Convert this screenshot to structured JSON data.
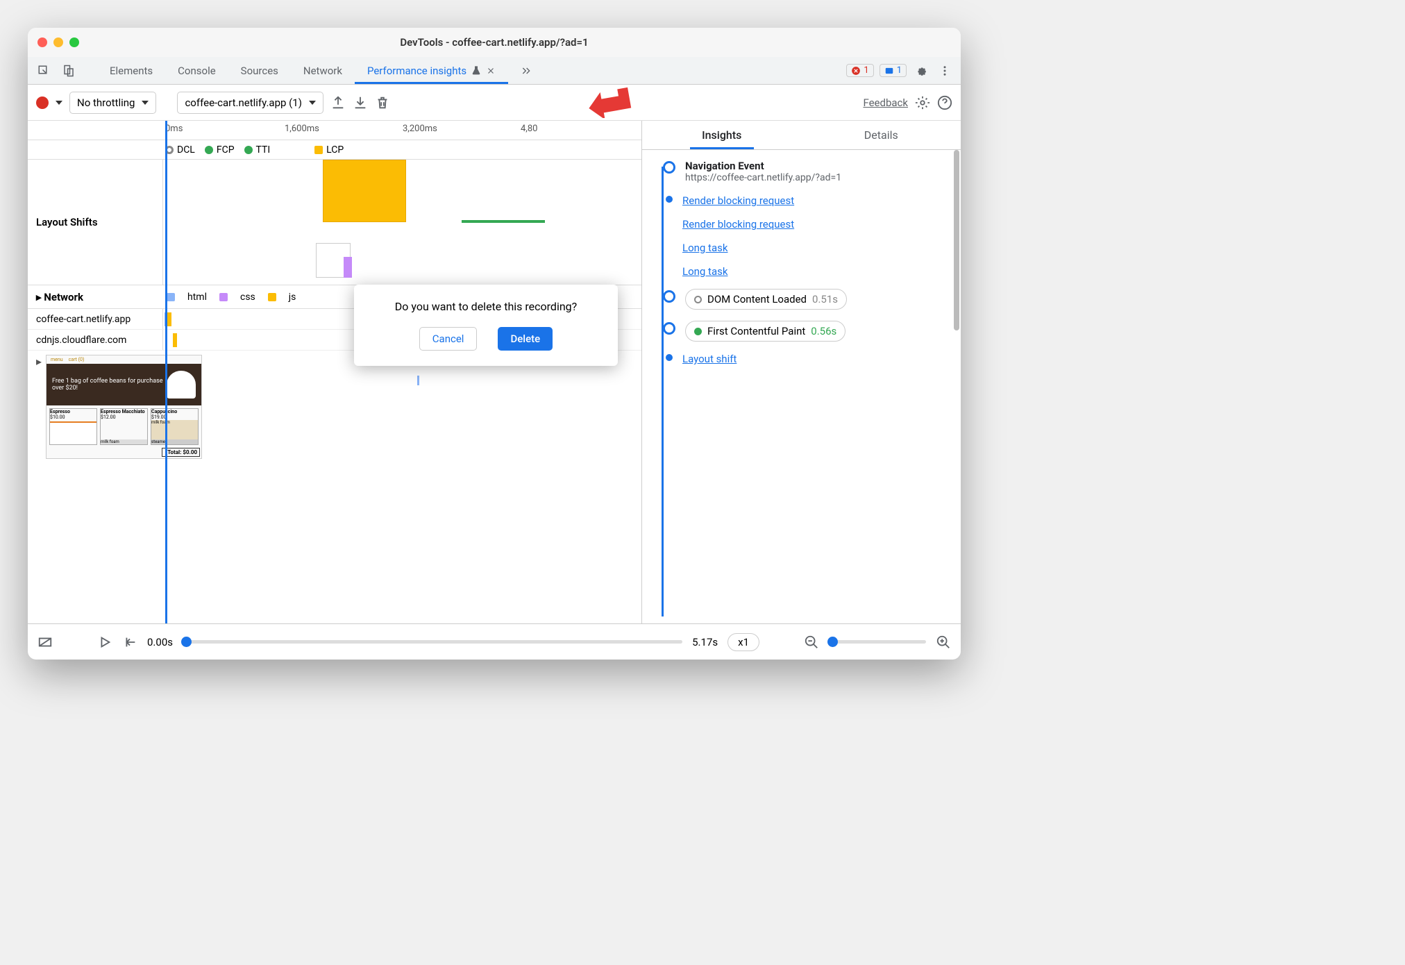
{
  "window": {
    "title": "DevTools - coffee-cart.netlify.app/?ad=1"
  },
  "tabs": {
    "elements": "Elements",
    "console": "Console",
    "sources": "Sources",
    "network": "Network",
    "perf_insights": "Performance insights"
  },
  "badges": {
    "errors": "1",
    "messages": "1"
  },
  "toolbar": {
    "throttling": "No throttling",
    "recording": "coffee-cart.netlify.app (1)",
    "feedback": "Feedback"
  },
  "ruler": {
    "t0": "0ms",
    "t1": "1,600ms",
    "t2": "3,200ms",
    "t3": "4,80"
  },
  "markers": {
    "dcl": "DCL",
    "fcp": "FCP",
    "tti": "TTI",
    "lcp": "LCP"
  },
  "sections": {
    "layout_shifts": "Layout Shifts",
    "network": "Network"
  },
  "net_legend": {
    "html": "html",
    "css": "css",
    "js": "js"
  },
  "domains": {
    "d1": "coffee-cart.netlify.app",
    "d2": "cdnjs.cloudflare.com"
  },
  "thumb": {
    "banner": "Free 1 bag of coffee beans for purchase over $20!",
    "p1": "Espresso",
    "p1p": "$10.00",
    "p2": "Espresso Macchiato",
    "p2p": "$12.00",
    "p3": "Cappuccino",
    "p3p": "$19.00",
    "mf": "milk foam",
    "st": "steamed",
    "total": "Total: $0.00",
    "menu": "menu",
    "cart": "cart (0)"
  },
  "bottom": {
    "start": "0.00s",
    "end": "5.17s",
    "speed": "x1"
  },
  "right_tabs": {
    "insights": "Insights",
    "details": "Details"
  },
  "insights": {
    "nav_title": "Navigation Event",
    "nav_url": "https://coffee-cart.netlify.app/?ad=1",
    "rbr": "Render blocking request",
    "long_task": "Long task",
    "dcl_label": "DOM Content Loaded",
    "dcl_time": "0.51s",
    "fcp_label": "First Contentful Paint",
    "fcp_time": "0.56s",
    "layout_shift": "Layout shift"
  },
  "dialog": {
    "text": "Do you want to delete this recording?",
    "cancel": "Cancel",
    "delete": "Delete"
  },
  "colors": {
    "blue": "#1a73e8",
    "green": "#34a853",
    "orange": "#fbbc04",
    "html": "#8ab4f8",
    "css": "#c58af9",
    "js": "#fbbc04"
  }
}
